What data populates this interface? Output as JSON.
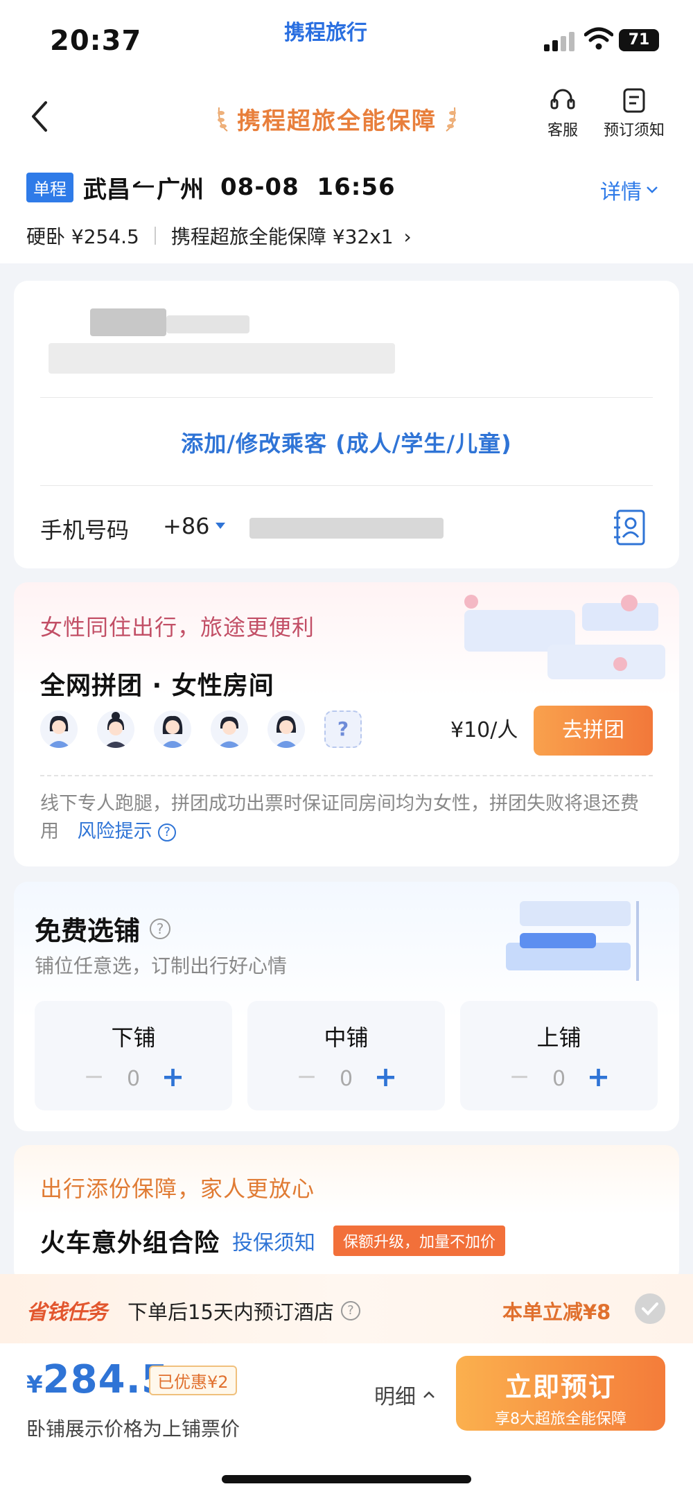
{
  "status_bar": {
    "time": "20:37",
    "app_brand": "携程旅行",
    "battery": "71"
  },
  "nav": {
    "title": "携程超旅全能保障",
    "customer_service": "客服",
    "booking_notice": "预订须知"
  },
  "trip": {
    "type_badge": "单程",
    "origin": "武昌",
    "destination": "广州",
    "datetime": "08-08  16:56",
    "detail_link": "详情",
    "seat_price": "硬卧 ¥254.5",
    "insurance_price": "携程超旅全能保障 ¥32x1"
  },
  "passenger": {
    "add_label": "添加/修改乘客 (成人/学生/儿童)",
    "phone_label": "手机号码",
    "country_code": "+86"
  },
  "female_group": {
    "title": "女性同住出行，旅途更便利",
    "subtitle": "全网拼团 · 女性房间",
    "unknown_slot": "?",
    "price": "¥10/人",
    "join_label": "去拼团",
    "note": "线下专人跑腿，拼团成功出票时保证同房间均为女性，拼团失败将退还费用",
    "risk_link": "风险提示"
  },
  "berth": {
    "title": "免费选铺",
    "subtitle": "铺位任意选，订制出行好心情",
    "options": [
      {
        "name": "下铺",
        "qty": "0"
      },
      {
        "name": "中铺",
        "qty": "0"
      },
      {
        "name": "上铺",
        "qty": "0"
      }
    ]
  },
  "insurance": {
    "title": "出行添份保障，家人更放心",
    "name": "火车意外组合险",
    "notice_link": "投保须知",
    "tag": "保额升级，加量不加价"
  },
  "task": {
    "logo": "省钱任务",
    "text": "下单后15天内预订酒店",
    "saving": "本单立减¥8"
  },
  "bottom": {
    "currency": "¥",
    "total": "284.5",
    "discount": "已优惠¥2",
    "price_note": "卧铺展示价格为上铺票价",
    "detail_label": "明细",
    "book_label": "立即预订",
    "book_sub": "享8大超旅全能保障"
  },
  "colors": {
    "accent_blue": "#2f74d6",
    "accent_orange": "#f47c3a",
    "female_pink": "#c24f66"
  }
}
